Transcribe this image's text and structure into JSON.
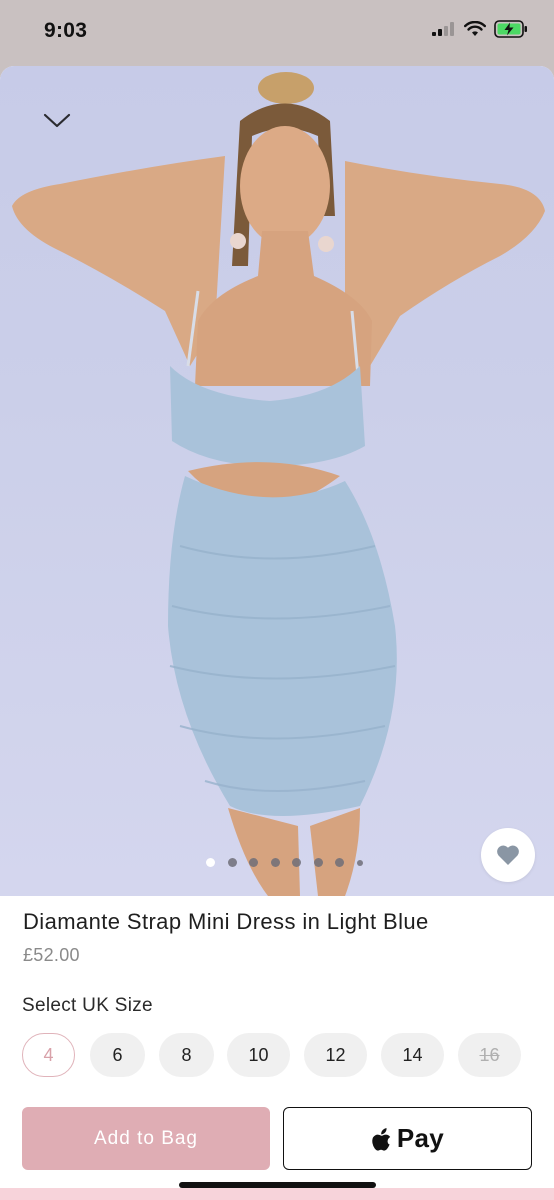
{
  "status_bar": {
    "time": "9:03",
    "icons": [
      "signal-icon",
      "wifi-icon",
      "battery-charging-icon"
    ]
  },
  "hero": {
    "collapse_icon": "chevron-down-icon",
    "favorite_icon": "heart-icon",
    "image_description": "",
    "carousel": {
      "total": 8,
      "active_index": 0
    }
  },
  "product": {
    "title": "Diamante Strap Mini Dress in Light Blue",
    "price": "£52.00"
  },
  "size_selector": {
    "label": "Select UK Size",
    "sizes": [
      {
        "value": "4",
        "state": "selected"
      },
      {
        "value": "6",
        "state": "available"
      },
      {
        "value": "8",
        "state": "available"
      },
      {
        "value": "10",
        "state": "available"
      },
      {
        "value": "12",
        "state": "available"
      },
      {
        "value": "14",
        "state": "available"
      },
      {
        "value": "16",
        "state": "unavailable"
      }
    ]
  },
  "actions": {
    "add_to_bag": "Add to Bag",
    "apple_pay": "Pay",
    "apple_pay_icon": "apple-logo-icon"
  },
  "colors": {
    "accent_pink": "#dfadb4",
    "selected_border": "#e0b3ba",
    "hero_bg": "#c9cde8",
    "dress_blue": "#a9c2da"
  }
}
